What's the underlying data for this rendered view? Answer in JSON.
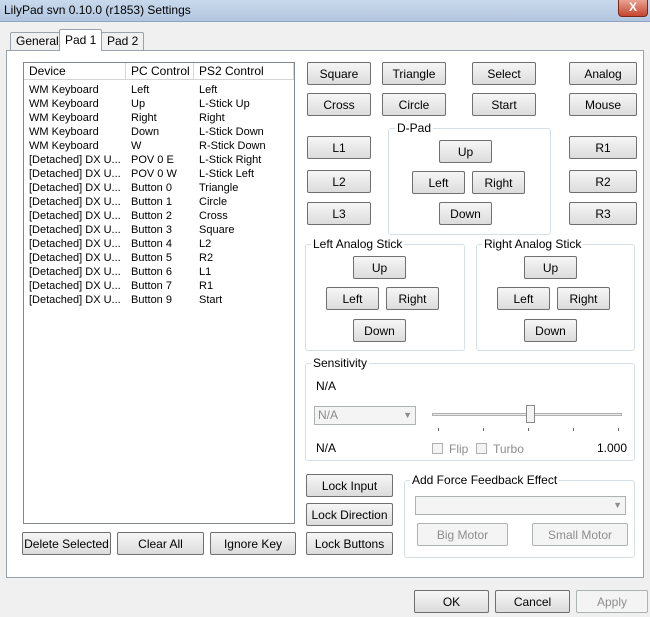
{
  "window": {
    "title": "LilyPad svn 0.10.0 (r1853) Settings",
    "close_glyph": "X"
  },
  "tabs": [
    {
      "label": "General"
    },
    {
      "label": "Pad 1"
    },
    {
      "label": "Pad 2"
    }
  ],
  "bindings": {
    "columns": [
      "Device",
      "PC Control",
      "PS2 Control"
    ],
    "rows": [
      [
        "WM Keyboard",
        "Left",
        "Left"
      ],
      [
        "WM Keyboard",
        "Up",
        "L-Stick Up"
      ],
      [
        "WM Keyboard",
        "Right",
        "Right"
      ],
      [
        "WM Keyboard",
        "Down",
        "L-Stick Down"
      ],
      [
        "WM Keyboard",
        "W",
        "R-Stick Down"
      ],
      [
        "[Detached] DX U...",
        "POV 0 E",
        "L-Stick Right"
      ],
      [
        "[Detached] DX U...",
        "POV 0 W",
        "L-Stick Left"
      ],
      [
        "[Detached] DX U...",
        "Button 0",
        "Triangle"
      ],
      [
        "[Detached] DX U...",
        "Button 1",
        "Circle"
      ],
      [
        "[Detached] DX U...",
        "Button 2",
        "Cross"
      ],
      [
        "[Detached] DX U...",
        "Button 3",
        "Square"
      ],
      [
        "[Detached] DX U...",
        "Button 4",
        "L2"
      ],
      [
        "[Detached] DX U...",
        "Button 5",
        "R2"
      ],
      [
        "[Detached] DX U...",
        "Button 6",
        "L1"
      ],
      [
        "[Detached] DX U...",
        "Button 7",
        "R1"
      ],
      [
        "[Detached] DX U...",
        "Button 9",
        "Start"
      ]
    ]
  },
  "list_actions": {
    "delete": "Delete Selected",
    "clear": "Clear All",
    "ignore": "Ignore Key"
  },
  "face_buttons": {
    "square": "Square",
    "triangle": "Triangle",
    "select": "Select",
    "analog": "Analog",
    "cross": "Cross",
    "circle": "Circle",
    "start": "Start",
    "mouse": "Mouse",
    "l1": "L1",
    "l2": "L2",
    "l3": "L3",
    "r1": "R1",
    "r2": "R2",
    "r3": "R3"
  },
  "dpad": {
    "label": "D-Pad",
    "up": "Up",
    "left": "Left",
    "right": "Right",
    "down": "Down"
  },
  "left_stick": {
    "label": "Left Analog Stick",
    "up": "Up",
    "left": "Left",
    "right": "Right",
    "down": "Down"
  },
  "right_stick": {
    "label": "Right Analog Stick",
    "up": "Up",
    "left": "Left",
    "right": "Right",
    "down": "Down"
  },
  "sensitivity": {
    "label": "Sensitivity",
    "top_text": "N/A",
    "combo_value": "N/A",
    "bottom_text": "N/A",
    "flip_label": "Flip",
    "turbo_label": "Turbo",
    "value": "1.000",
    "slider_fraction": 0.5
  },
  "lock": {
    "input": "Lock Input",
    "direction": "Lock Direction",
    "buttons": "Lock Buttons"
  },
  "force_feedback": {
    "label": "Add Force Feedback Effect",
    "big_motor": "Big Motor",
    "small_motor": "Small Motor"
  },
  "dialog": {
    "ok": "OK",
    "cancel": "Cancel",
    "apply": "Apply"
  }
}
